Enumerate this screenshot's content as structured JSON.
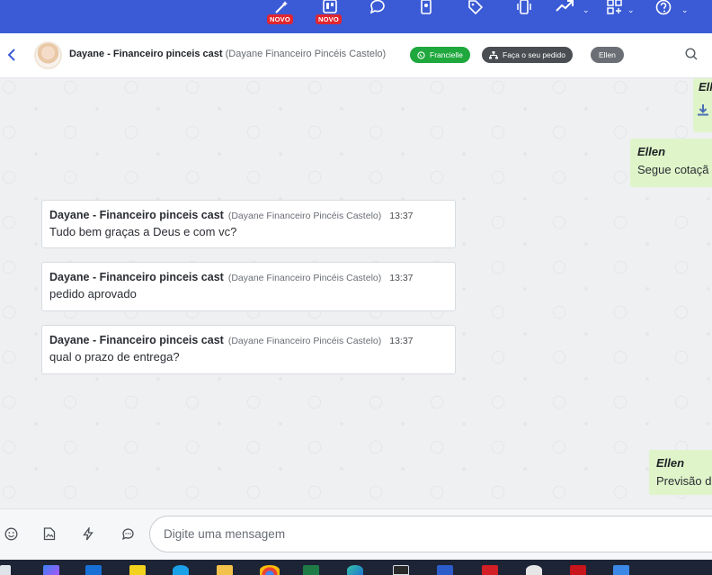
{
  "toolbar": {
    "new_badge_1": "NOVO",
    "new_badge_2": "NOVO"
  },
  "header": {
    "contact_name": "Dayane - Financeiro pinceis cast",
    "contact_subtitle": "(Dayane Financeiro Pincéis Castelo)",
    "tags": [
      {
        "label": "Francielle",
        "color": "#1fa83d"
      },
      {
        "label": "Faça o seu pedido",
        "color": "#4a4d52"
      },
      {
        "label": "Ellen",
        "color": "#6b6f75"
      }
    ]
  },
  "messages": {
    "top_partial_name": "Ell",
    "outgoing_1": {
      "name": "Ellen",
      "text": "Segue cotaçã"
    },
    "incoming": [
      {
        "name": "Dayane - Financeiro pinceis cast",
        "sub": "(Dayane Financeiro Pincéis Castelo)",
        "time": "13:37",
        "text": "Tudo bem graças a Deus e com vc?"
      },
      {
        "name": "Dayane - Financeiro pinceis cast",
        "sub": "(Dayane Financeiro Pincéis Castelo)",
        "time": "13:37",
        "text": "pedido aprovado"
      },
      {
        "name": "Dayane - Financeiro pinceis cast",
        "sub": "(Dayane Financeiro Pincéis Castelo)",
        "time": "13:37",
        "text": "qual o prazo de entrega?"
      }
    ],
    "outgoing_2": {
      "name": "Ellen",
      "text": "Previsão d"
    }
  },
  "composer": {
    "placeholder": "Digite uma mensagem"
  },
  "colors": {
    "toolbar_bg": "#3b5bd6",
    "outgoing_bg": "#dff5c9",
    "badge_red": "#e0262f"
  }
}
